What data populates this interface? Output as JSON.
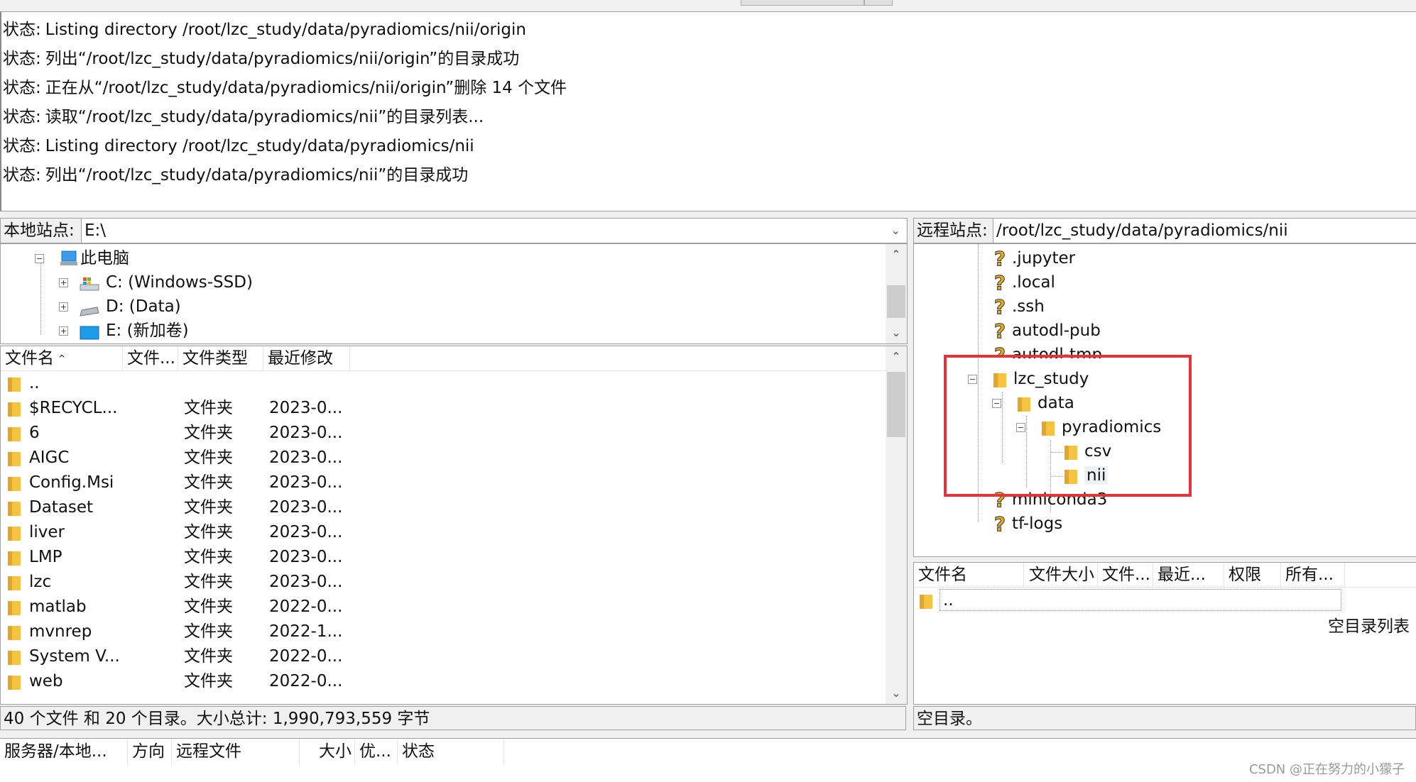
{
  "log": [
    {
      "label": "状态:",
      "text": "Listing directory /root/lzc_study/data/pyradiomics/nii/origin"
    },
    {
      "label": "状态:",
      "text": "列出“/root/lzc_study/data/pyradiomics/nii/origin”的目录成功"
    },
    {
      "label": "状态:",
      "text": "正在从“/root/lzc_study/data/pyradiomics/nii/origin”删除 14 个文件"
    },
    {
      "label": "状态:",
      "text": "读取“/root/lzc_study/data/pyradiomics/nii”的目录列表..."
    },
    {
      "label": "状态:",
      "text": "Listing directory /root/lzc_study/data/pyradiomics/nii"
    },
    {
      "label": "状态:",
      "text": "列出“/root/lzc_study/data/pyradiomics/nii”的目录成功"
    }
  ],
  "local": {
    "site_label": "本地站点:",
    "site_value": "E:\\",
    "tree": [
      {
        "label": "此电脑",
        "icon": "computer-icon"
      },
      {
        "label": "C: (Windows-SSD)",
        "icon": "windows-drive-icon"
      },
      {
        "label": "D: (Data)",
        "icon": "drive-icon"
      },
      {
        "label": "E: (新加卷)",
        "icon": "drive-icon"
      }
    ],
    "columns": {
      "name": "文件名",
      "size": "文件...",
      "type": "文件类型",
      "modified": "最近修改"
    },
    "files": [
      {
        "name": "..",
        "type": "",
        "modified": ""
      },
      {
        "name": "$RECYCL...",
        "type": "文件夹",
        "modified": "2023-0..."
      },
      {
        "name": "6",
        "type": "文件夹",
        "modified": "2023-0..."
      },
      {
        "name": "AIGC",
        "type": "文件夹",
        "modified": "2023-0..."
      },
      {
        "name": "Config.Msi",
        "type": "文件夹",
        "modified": "2023-0..."
      },
      {
        "name": "Dataset",
        "type": "文件夹",
        "modified": "2023-0..."
      },
      {
        "name": "liver",
        "type": "文件夹",
        "modified": "2023-0..."
      },
      {
        "name": "LMP",
        "type": "文件夹",
        "modified": "2023-0..."
      },
      {
        "name": "lzc",
        "type": "文件夹",
        "modified": "2023-0..."
      },
      {
        "name": "matlab",
        "type": "文件夹",
        "modified": "2022-0..."
      },
      {
        "name": "mvnrep",
        "type": "文件夹",
        "modified": "2022-1..."
      },
      {
        "name": "System V...",
        "type": "文件夹",
        "modified": "2022-0..."
      },
      {
        "name": "web",
        "type": "文件夹",
        "modified": "2022-0..."
      }
    ],
    "status": "40 个文件 和 20 个目录。大小总计: 1,990,793,559 字节"
  },
  "remote": {
    "site_label": "远程站点:",
    "site_value": "/root/lzc_study/data/pyradiomics/nii",
    "tree": [
      {
        "label": ".jupyter",
        "icon": "unknown-icon"
      },
      {
        "label": ".local",
        "icon": "unknown-icon"
      },
      {
        "label": ".ssh",
        "icon": "unknown-icon"
      },
      {
        "label": "autodl-pub",
        "icon": "unknown-icon"
      },
      {
        "label": "autodl-tmp",
        "icon": "unknown-icon"
      },
      {
        "label": "lzc_study",
        "icon": "folder-icon"
      },
      {
        "label": "data",
        "icon": "folder-icon"
      },
      {
        "label": "pyradiomics",
        "icon": "folder-icon"
      },
      {
        "label": "csv",
        "icon": "folder-icon"
      },
      {
        "label": "nii",
        "icon": "folder-icon"
      },
      {
        "label": "miniconda3",
        "icon": "unknown-icon"
      },
      {
        "label": "tf-logs",
        "icon": "unknown-icon"
      }
    ],
    "columns": {
      "name": "文件名",
      "size": "文件大小",
      "type": "文件...",
      "modified": "最近...",
      "perms": "权限",
      "owner": "所有..."
    },
    "files": [
      {
        "name": ".."
      }
    ],
    "empty_text": "空目录列表",
    "status": "空目录。"
  },
  "queue": {
    "columns": [
      "服务器/本地...",
      "方向",
      "远程文件",
      "大小",
      "优...",
      "状态"
    ]
  },
  "watermark": "CSDN @正在努力的小獴子",
  "colors": {
    "highlight_box": "#e5333a",
    "folder": "#f5c342",
    "unknown": "#e6ac1f"
  }
}
